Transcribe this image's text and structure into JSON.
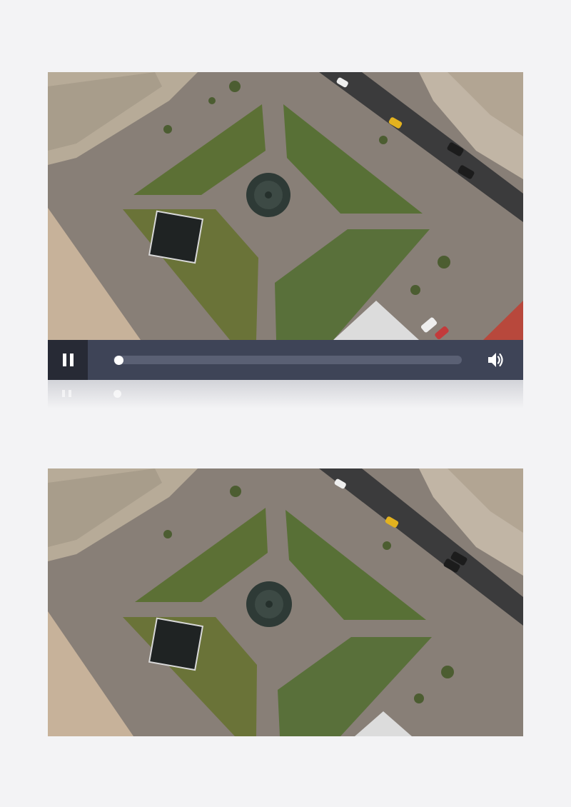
{
  "player": {
    "state": "playing",
    "progress": 0.0,
    "colors": {
      "control_bar": "#3e4457",
      "play_button_bg": "#272a35",
      "track": "#5a6074",
      "knob": "#ffffff"
    },
    "icons": {
      "play_pause": "pause-icon",
      "volume": "volume-icon"
    }
  }
}
